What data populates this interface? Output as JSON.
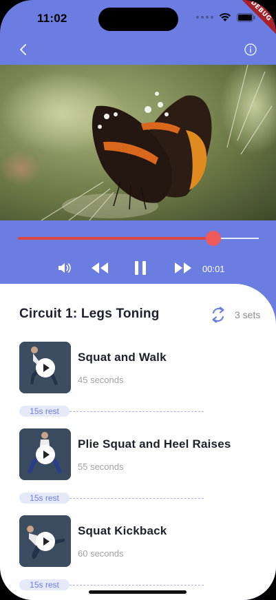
{
  "status_bar": {
    "time": "11:02",
    "debug_label": "DEBUG"
  },
  "app_bar": {
    "back_icon": "chevron-left-icon",
    "info_icon": "info-icon"
  },
  "player": {
    "progress": 0.81,
    "elapsed": "00:01",
    "volume_icon": "volume-icon",
    "rewind_icon": "rewind-icon",
    "pause_icon": "pause-icon",
    "forward_icon": "fast-forward-icon"
  },
  "circuit": {
    "title": "Circuit 1: Legs Toning",
    "repeat_icon": "repeat-icon",
    "sets": "3 sets"
  },
  "exercises": [
    {
      "name": "Squat and Walk",
      "duration": "45 seconds",
      "rest": "15s rest"
    },
    {
      "name": "Plie Squat and Heel Raises",
      "duration": "55 seconds",
      "rest": "15s rest"
    },
    {
      "name": "Squat Kickback",
      "duration": "60 seconds",
      "rest": "15s rest"
    }
  ],
  "colors": {
    "primary": "#6b7de0",
    "accent_red": "#e0453f",
    "rest_pill_bg": "#e6eaf8",
    "text_dark": "#1f1f2e",
    "text_muted": "#a0a0aa"
  }
}
